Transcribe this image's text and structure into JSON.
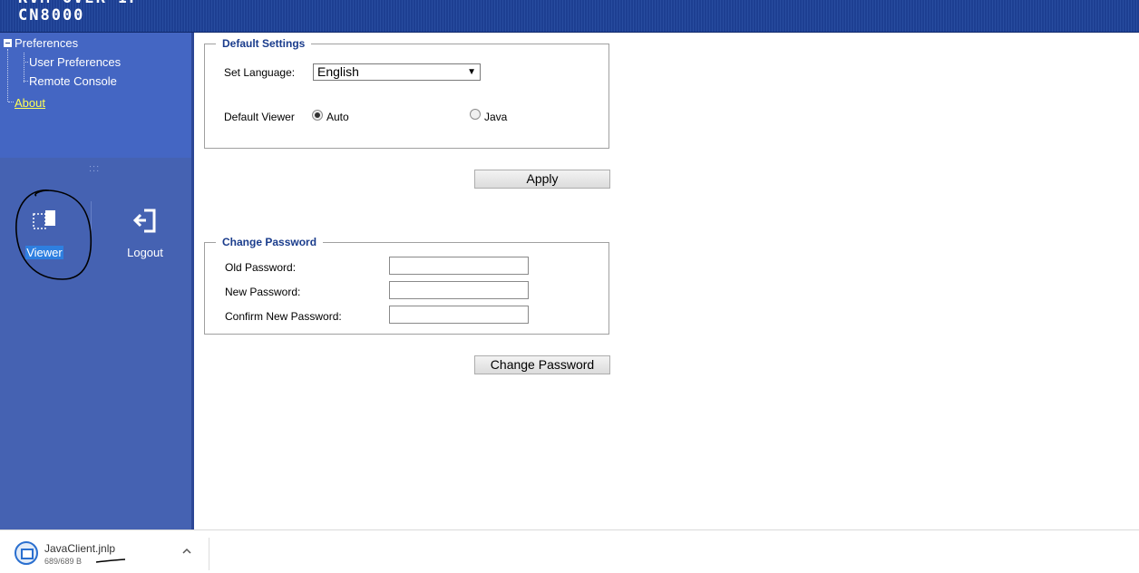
{
  "header": {
    "model_top": "KVM OVER IP",
    "model": "CN8000"
  },
  "sidebar": {
    "tree": {
      "root": "Preferences",
      "children": [
        "User Preferences",
        "Remote Console"
      ],
      "about": "About"
    },
    "grip": ":::",
    "tools": {
      "viewer": "Viewer",
      "logout": "Logout"
    }
  },
  "default_settings": {
    "legend": "Default Settings",
    "language_label": "Set Language:",
    "language_value": "English",
    "viewer_label": "Default Viewer",
    "options": [
      "Auto",
      "Java"
    ],
    "selected": "Auto",
    "apply": "Apply"
  },
  "change_password": {
    "legend": "Change Password",
    "old_label": "Old Password:",
    "new_label": "New Password:",
    "confirm_label": "Confirm New Password:",
    "old_value": "",
    "new_value": "",
    "confirm_value": "",
    "button": "Change Password"
  },
  "download_bar": {
    "file_name": "JavaClient.jnlp",
    "file_size": "689/689 B"
  },
  "colors": {
    "header_blue": "#1d3f92",
    "sidebar_blue": "#4466c3",
    "about_link": "#ffff55",
    "legend_text": "#1a3c8c"
  }
}
